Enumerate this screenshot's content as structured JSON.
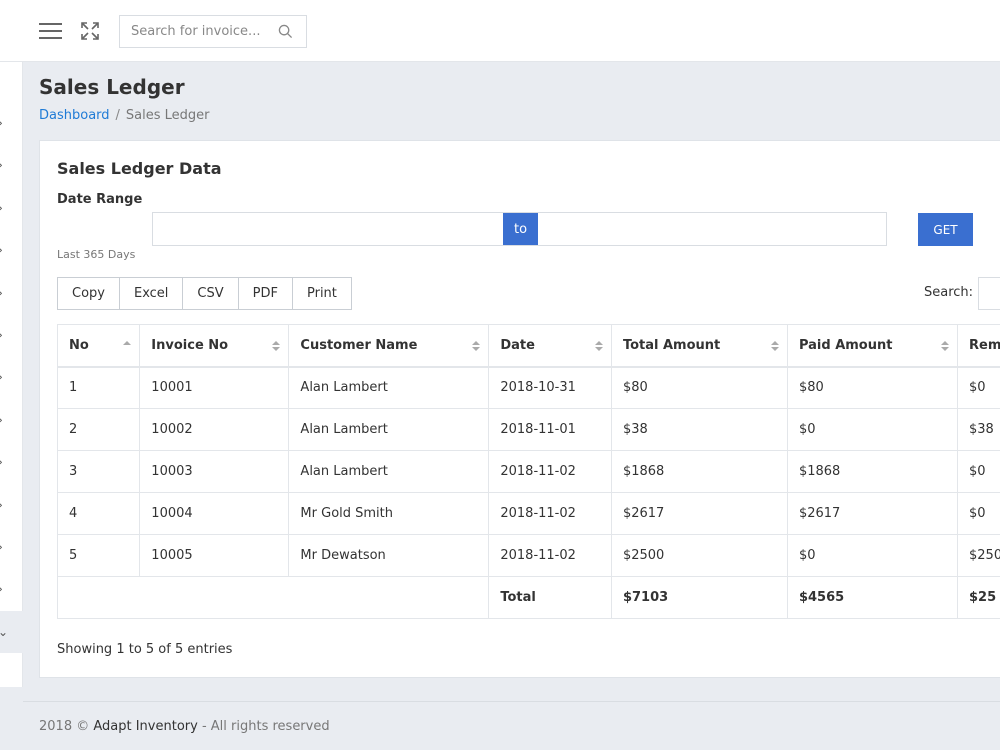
{
  "header": {
    "search_placeholder": "Search for invoice..."
  },
  "sidebar": {
    "items": [
      {
        "icon": "chevron-right-icon",
        "glyph": "›"
      },
      {
        "icon": "chevron-right-icon",
        "glyph": "›"
      },
      {
        "icon": "chevron-right-icon",
        "glyph": "›"
      },
      {
        "icon": "chevron-right-icon",
        "glyph": "›"
      },
      {
        "icon": "chevron-right-icon",
        "glyph": "›"
      },
      {
        "icon": "chevron-right-icon",
        "glyph": "›"
      },
      {
        "icon": "chevron-right-icon",
        "glyph": "›"
      },
      {
        "icon": "chevron-right-icon",
        "glyph": "›"
      },
      {
        "icon": "chevron-right-icon",
        "glyph": "›"
      },
      {
        "icon": "chevron-right-icon",
        "glyph": "›"
      },
      {
        "icon": "chevron-right-icon",
        "glyph": "›"
      },
      {
        "icon": "chevron-right-icon",
        "glyph": "›"
      },
      {
        "icon": "chevron-down-icon",
        "glyph": "⌄",
        "active": true
      }
    ]
  },
  "page": {
    "title": "Sales Ledger",
    "breadcrumb": {
      "home": "Dashboard",
      "separator": "/",
      "current": "Sales Ledger"
    }
  },
  "card": {
    "title": "Sales Ledger Data",
    "date_label": "Date Range",
    "date_hint": "Last 365 Days",
    "date_start": "",
    "date_end": "",
    "to_label": "to",
    "get_label": "GET"
  },
  "export_buttons": [
    "Copy",
    "Excel",
    "CSV",
    "PDF",
    "Print"
  ],
  "table_search": {
    "label": "Search:",
    "value": ""
  },
  "table": {
    "columns": [
      "No",
      "Invoice No",
      "Customer Name",
      "Date",
      "Total Amount",
      "Paid Amount",
      "Rem"
    ],
    "rows": [
      [
        "1",
        "10001",
        "Alan Lambert",
        "2018-10-31",
        "$80",
        "$80",
        "$0"
      ],
      [
        "2",
        "10002",
        "Alan Lambert",
        "2018-11-01",
        "$38",
        "$0",
        "$38"
      ],
      [
        "3",
        "10003",
        "Alan Lambert",
        "2018-11-02",
        "$1868",
        "$1868",
        "$0"
      ],
      [
        "4",
        "10004",
        "Mr Gold Smith",
        "2018-11-02",
        "$2617",
        "$2617",
        "$0"
      ],
      [
        "5",
        "10005",
        "Mr Dewatson",
        "2018-11-02",
        "$2500",
        "$0",
        "$250"
      ]
    ],
    "totals": {
      "label": "Total",
      "total_amount": "$7103",
      "paid_amount": "$4565",
      "remaining": "$25"
    }
  },
  "entries_info": "Showing 1 to 5 of 5 entries",
  "footer": {
    "prefix": "2018 © ",
    "brand": "Adapt Inventory",
    "suffix": " - All rights reserved"
  },
  "colors": {
    "accent": "#3a6fd0",
    "link": "#1f7bd6",
    "background": "#e9ecf1"
  }
}
